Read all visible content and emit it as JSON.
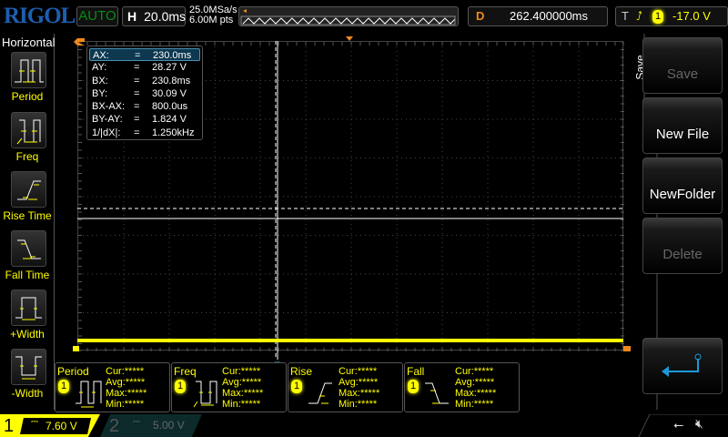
{
  "header": {
    "logo": "RIGOL",
    "run_status": "AUTO",
    "timebase_label": "H",
    "timebase": "20.0ms",
    "sample_rate": "25.0MSa/s",
    "memory_depth": "6.00M pts",
    "delay_label": "D",
    "delay": "262.400000ms",
    "trigger_label": "T",
    "trigger_source": "1",
    "trigger_level": "-17.0 V"
  },
  "left_menu": {
    "title": "Horizontal",
    "items": [
      {
        "label": "Period"
      },
      {
        "label": "Freq"
      },
      {
        "label": "Rise Time"
      },
      {
        "label": "Fall Time"
      },
      {
        "label": "+Width"
      },
      {
        "label": "-Width"
      }
    ]
  },
  "right_menu": {
    "title": "Save",
    "buttons": [
      {
        "label": "Save",
        "enabled": false
      },
      {
        "label": "New File",
        "enabled": true
      },
      {
        "label": "NewFolder",
        "enabled": true
      },
      {
        "label": "Delete",
        "enabled": false
      }
    ]
  },
  "cursor_readout": [
    {
      "name": "AX:",
      "eq": "=",
      "value": "230.0ms"
    },
    {
      "name": "AY:",
      "eq": "=",
      "value": "28.27 V"
    },
    {
      "name": "BX:",
      "eq": "=",
      "value": "230.8ms"
    },
    {
      "name": "BY:",
      "eq": "=",
      "value": "30.09 V"
    },
    {
      "name": "BX-AX:",
      "eq": "=",
      "value": "800.0us"
    },
    {
      "name": "BY-AY:",
      "eq": "=",
      "value": "1.824 V"
    },
    {
      "name": "1/|dX|:",
      "eq": "=",
      "value": "1.250kHz"
    }
  ],
  "measurements": [
    {
      "title": "Period",
      "source": "1",
      "cur": "Cur:*****",
      "avg": "Avg:*****",
      "max": "Max:*****",
      "min": "Min:*****"
    },
    {
      "title": "Freq",
      "source": "1",
      "cur": "Cur:*****",
      "avg": "Avg:*****",
      "max": "Max:*****",
      "min": "Min:*****"
    },
    {
      "title": "Rise",
      "source": "1",
      "cur": "Cur:*****",
      "avg": "Avg:*****",
      "max": "Max:*****",
      "min": "Min:*****"
    },
    {
      "title": "Fall",
      "source": "1",
      "cur": "Cur:*****",
      "avg": "Avg:*****",
      "max": "Max:*****",
      "min": "Min:*****"
    }
  ],
  "channels": [
    {
      "num": "1",
      "scale": "7.60 V",
      "active": true,
      "color": "#ffff00"
    },
    {
      "num": "2",
      "scale": "5.00 V",
      "active": false,
      "color": "#00c0c0"
    }
  ],
  "colors": {
    "ch1": "#ffff00",
    "cursor": "#ffffff",
    "delay": "#f08a1c",
    "logo": "#1d5fb0"
  }
}
